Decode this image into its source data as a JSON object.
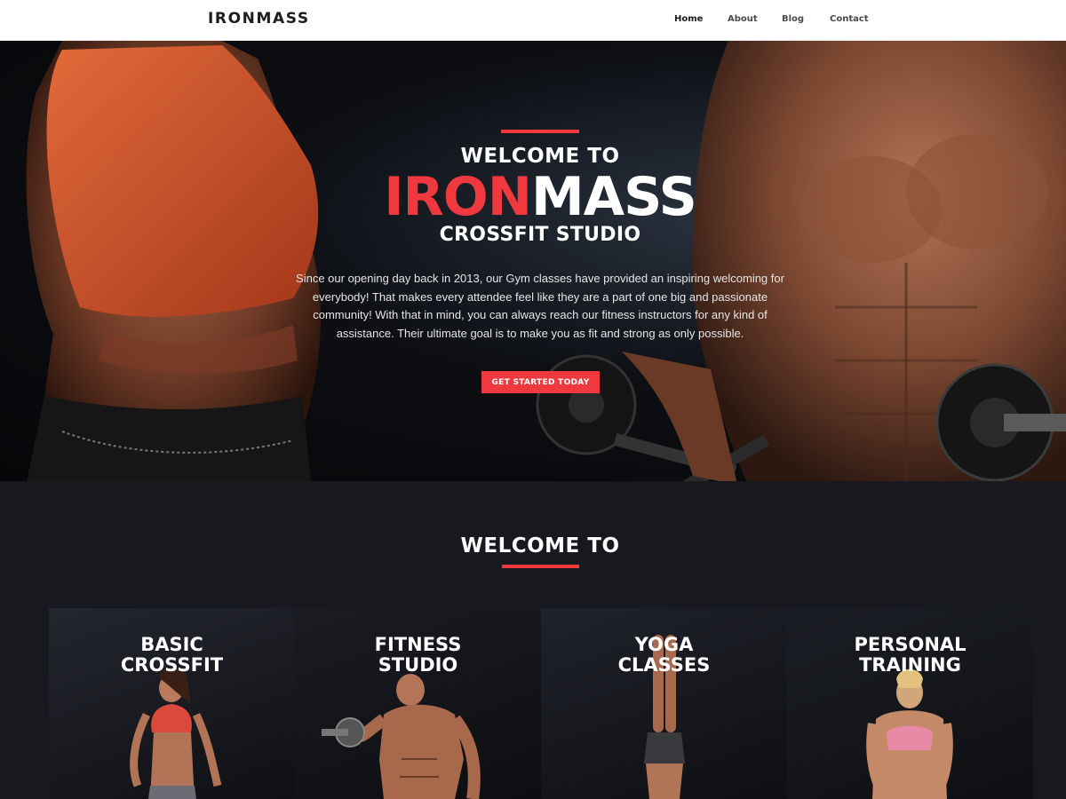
{
  "header": {
    "logo": "IRONMASS",
    "nav": [
      {
        "label": "Home",
        "active": true
      },
      {
        "label": "About",
        "active": false
      },
      {
        "label": "Blog",
        "active": false
      },
      {
        "label": "Contact",
        "active": false
      }
    ]
  },
  "hero": {
    "welcome": "WELCOME TO",
    "brand_red": "IRON",
    "brand_white": "MASS",
    "subtitle": "CROSSFIT STUDIO",
    "text": "Since our opening day back in 2013, our Gym classes have provided an inspiring welcoming for everybody! That makes every attendee feel like they are a part of one big and passionate community! With that in mind, you can always reach our fitness instructors for any kind of assistance. Their ultimate goal is to make you as fit and strong as only possible.",
    "button": "GET STARTED TODAY"
  },
  "section": {
    "title": "WELCOME TO",
    "cards": [
      {
        "title": "BASIC\nCROSSFIT"
      },
      {
        "title": "FITNESS\nSTUDIO"
      },
      {
        "title": "YOGA\nCLASSES"
      },
      {
        "title": "PERSONAL\nTRAINING"
      }
    ]
  },
  "colors": {
    "accent": "#f0393f",
    "dark_bg": "#17191e",
    "header_bg": "#ffffff"
  }
}
